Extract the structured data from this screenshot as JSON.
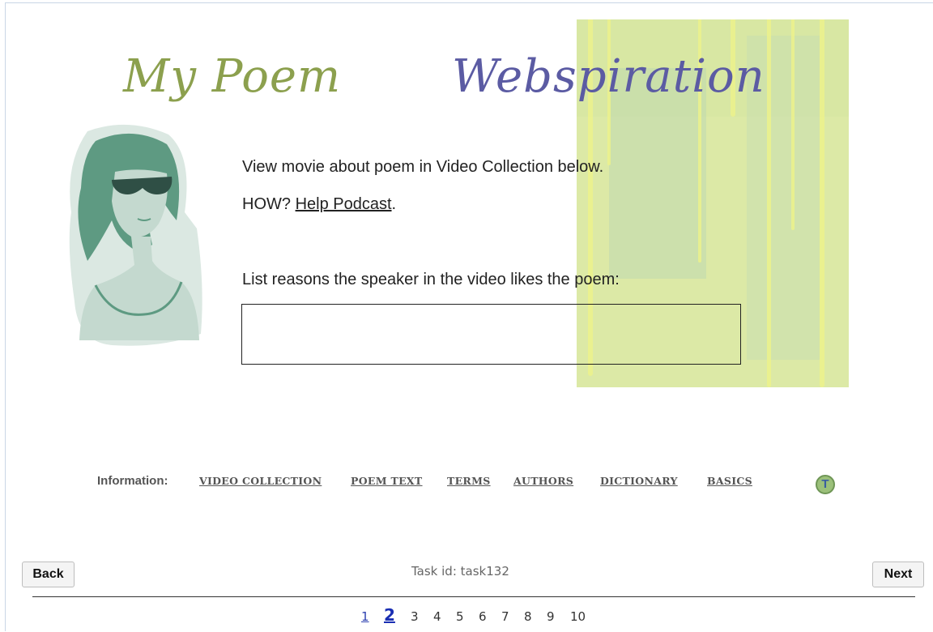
{
  "header": {
    "title_part1": "My Poem",
    "title_part2": "Webspiration"
  },
  "content": {
    "instruction_line1": "View movie about poem in Video Collection below.",
    "how_prefix": "HOW? ",
    "help_link": "Help Podcast",
    "how_suffix": ".",
    "prompt": "List reasons the speaker in the video likes the poem:",
    "answer_value": ""
  },
  "info_bar": {
    "label": "Information:",
    "links": [
      "VIDEO COLLECTION",
      "POEM TEXT",
      "TERMS",
      "AUTHORS",
      "DICTIONARY",
      "BASICS"
    ],
    "badge": "T"
  },
  "footer": {
    "back_label": "Back",
    "next_label": "Next",
    "task_id": "Task id: task132",
    "pages": [
      "1",
      "2",
      "3",
      "4",
      "5",
      "6",
      "7",
      "8",
      "9",
      "10"
    ],
    "current_page": "2"
  },
  "colors": {
    "title_green": "#8ca04e",
    "title_purple": "#5b5ba3",
    "panel_green": "#dce9a6",
    "link_blue": "#2c3fb0"
  }
}
